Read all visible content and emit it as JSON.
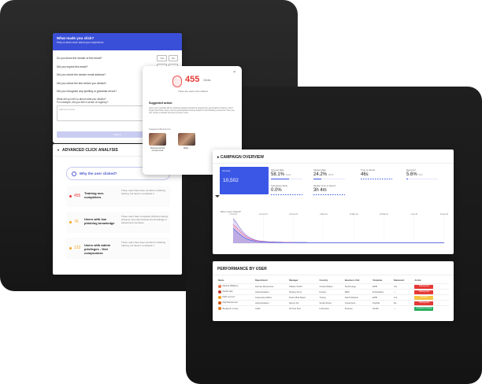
{
  "questionnaire": {
    "title": "What made you click?",
    "subtitle": "Help us learn more about your experience.",
    "questions": [
      "Do you know the sender of this email?",
      "Did you expect this email?",
      "Did you check the sender email address?",
      "Did you check the link before you clicked?",
      "Did you recognize any spelling or grammar errors?"
    ],
    "yes_label": "Yes",
    "no_label": "No",
    "text_question": "What did you tell us about what you clicked?",
    "text_question_sub": "For example, did you feel a sense of urgency?",
    "text_placeholder": "Add comments",
    "submit_label": "Submit"
  },
  "popup": {
    "close": "×",
    "count": "455",
    "count_unit": "Clicks",
    "small_text": "There are users who clicked",
    "heading": "Suggested action:",
    "paragraph": "Users who typically fall for phishing attacks should be targeted by personalized training. Don't forget that these users can be personalized training based on the following resources. Also you can review a related resource to learn more.",
    "resources_label": "Suggested Resources",
    "resources": [
      {
        "caption": "Business Email Compromise"
      },
      {
        "caption": "Malw..."
      }
    ]
  },
  "analysis": {
    "title": "ADVANCED CLICK ANALYSIS",
    "why_label": "Why the user clicked?",
    "segments": [
      {
        "count": "455",
        "label": "Training non-completers",
        "color": "#e53935",
        "desc": "These users have been enrolled in phishing training, but haven't completed it."
      },
      {
        "count": "76",
        "label": "Users with low phishing knowledge",
        "color": "#f5a623",
        "desc": "These users have completed phishing training. However, they demonstrate low knowledge in assessment exercises."
      },
      {
        "count": "123",
        "label": "Users with admin privileges - first compromise",
        "color": "#f5a623",
        "desc": "These users have been enrolled in phishing training, but haven't completed it."
      }
    ]
  },
  "overview": {
    "title": "CAMPAIGN OVERVIEW",
    "sent": {
      "label": "Sending",
      "value": "10,502"
    },
    "kpis": [
      {
        "label": "Opened Rate",
        "value": "58.1%",
        "sub": "6104",
        "fill": 0.58
      },
      {
        "label": "Clicked Rate",
        "value": "24.2%",
        "sub": "2545",
        "fill": 0.24
      },
      {
        "label": "Time on Email",
        "value": "46s",
        "sub": "",
        "fill": 0.0
      },
      {
        "label": "Reported",
        "value": "5.6%",
        "sub": "593",
        "fill": 0.06
      },
      {
        "label": "Submission Rate",
        "value": "0.0%",
        "sub": "",
        "fill": 0.0
      },
      {
        "label": "Median Time to Report",
        "value": "3h 4m",
        "sub": "",
        "fill": 0.0
      }
    ],
    "chart_title": "When users clicked?",
    "chart_data": {
      "type": "line",
      "x": [
        "1 Feb 24",
        "",
        "",
        "",
        "",
        "",
        "",
        "",
        "",
        "",
        "11 Feb 24",
        "",
        "",
        "",
        "",
        "",
        "",
        "",
        "",
        "",
        "21 Feb 24",
        "",
        "",
        "",
        "",
        "",
        "",
        "",
        "",
        "",
        "2 Mar 24",
        "",
        "",
        "",
        "",
        "",
        "",
        "",
        "",
        "",
        "12 Mar 24",
        "",
        "",
        "",
        "",
        "",
        "",
        "",
        "",
        "",
        "22 Mar 24",
        "",
        "",
        "",
        "",
        "",
        "",
        "",
        "",
        "",
        "1 Apr 24",
        "",
        "",
        "",
        "",
        "",
        "",
        "",
        "",
        "",
        "11 Apr 24"
      ],
      "tick_labels": [
        "1 Feb 24",
        "11 Feb 24",
        "21 Feb 24",
        "2 Mar 24",
        "12 Mar 24",
        "22 Mar 24",
        "1 Apr 24",
        "11 Apr 24"
      ],
      "series": [
        {
          "color": "#8e79d8",
          "values": [
            92,
            78,
            60,
            45,
            33,
            24,
            18,
            13,
            10,
            8,
            7,
            6,
            5,
            5,
            4,
            4,
            4,
            3,
            3,
            3,
            3,
            3,
            3,
            3,
            3,
            2,
            2,
            2,
            2,
            2,
            2,
            2,
            2,
            2,
            2,
            2,
            2,
            2,
            2,
            2,
            2,
            2,
            2,
            2,
            2,
            2,
            2,
            2,
            2,
            2,
            2,
            2,
            2,
            2,
            2,
            2,
            2,
            2,
            2,
            2,
            2,
            2,
            2,
            2,
            2,
            2,
            2,
            2,
            2,
            2,
            2
          ]
        },
        {
          "color": "#e86fa0",
          "values": [
            70,
            60,
            48,
            36,
            27,
            20,
            15,
            11,
            9,
            7,
            6,
            5,
            5,
            4,
            4,
            3,
            3,
            3,
            3,
            3,
            2,
            2,
            2,
            2,
            2,
            2,
            2,
            2,
            2,
            2,
            2,
            2,
            2,
            2,
            2,
            2,
            2,
            2,
            2,
            2,
            2,
            2,
            2,
            2,
            2,
            2,
            2,
            2,
            2,
            2,
            2,
            2,
            2,
            2,
            2,
            2,
            2,
            2,
            2,
            2,
            2,
            2,
            2,
            2,
            2,
            2,
            2,
            2,
            2,
            2,
            2
          ]
        },
        {
          "color": "#4a6cf0",
          "values": [
            55,
            45,
            35,
            26,
            19,
            14,
            10,
            8,
            6,
            5,
            4,
            4,
            3,
            3,
            3,
            3,
            2,
            2,
            2,
            2,
            2,
            2,
            2,
            2,
            2,
            2,
            2,
            2,
            2,
            2,
            2,
            2,
            2,
            2,
            2,
            2,
            2,
            2,
            2,
            2,
            2,
            2,
            2,
            2,
            2,
            2,
            2,
            2,
            2,
            2,
            2,
            2,
            2,
            2,
            2,
            2,
            2,
            2,
            2,
            2,
            2,
            2,
            2,
            2,
            2,
            2,
            2,
            2,
            2,
            2,
            2
          ]
        }
      ]
    }
  },
  "performance": {
    "title": "PERFORMANCE BY USER",
    "columns": [
      "Name",
      "Department",
      "Manager",
      "Country",
      "Business Unit",
      "Template",
      "Statement",
      "Action"
    ],
    "rows": [
      {
        "name": "Rachel Williams",
        "dept": "Human Resources",
        "manager": "Fabian Smith",
        "country": "United States",
        "bu": "Technology",
        "tpl": "EPB",
        "stmt": "Yes",
        "action": "Training Sent",
        "color": "#e53935",
        "avatar": "#e8784a"
      },
      {
        "name": "Sarah Hay",
        "dept": "Administration",
        "manager": "Mosley Knox",
        "country": "France",
        "bu": "R&D",
        "tpl": "Embedded",
        "stmt": "—",
        "action": "Training Sent",
        "color": "#e53935",
        "avatar": "#c0392b"
      },
      {
        "name": "Rahi Lennox",
        "dept": "Corporate Affairs",
        "manager": "Pedro Bell Read",
        "country": "Turkey",
        "bu": "North Division",
        "tpl": "EPB",
        "stmt": "Yes",
        "action": "Quiz Sent",
        "color": "#f5c542",
        "avatar": "#f39c12"
      },
      {
        "name": "Raji Ramkumar",
        "dept": "Administration",
        "manager": "Monty Xie",
        "country": "South Africa",
        "bu": "Customers",
        "tpl": "PayPal",
        "stmt": "No",
        "action": "Training Sent",
        "color": "#e53935",
        "avatar": "#d35400"
      },
      {
        "name": "Benjamin Jones",
        "dept": "Audit",
        "manager": "Ali Kurt Nox",
        "country": "Indonesia",
        "bu": "Finance",
        "tpl": "Netflix",
        "stmt": "—",
        "action": "Completed Training",
        "color": "#27ae60",
        "avatar": "#e67e22"
      }
    ]
  }
}
